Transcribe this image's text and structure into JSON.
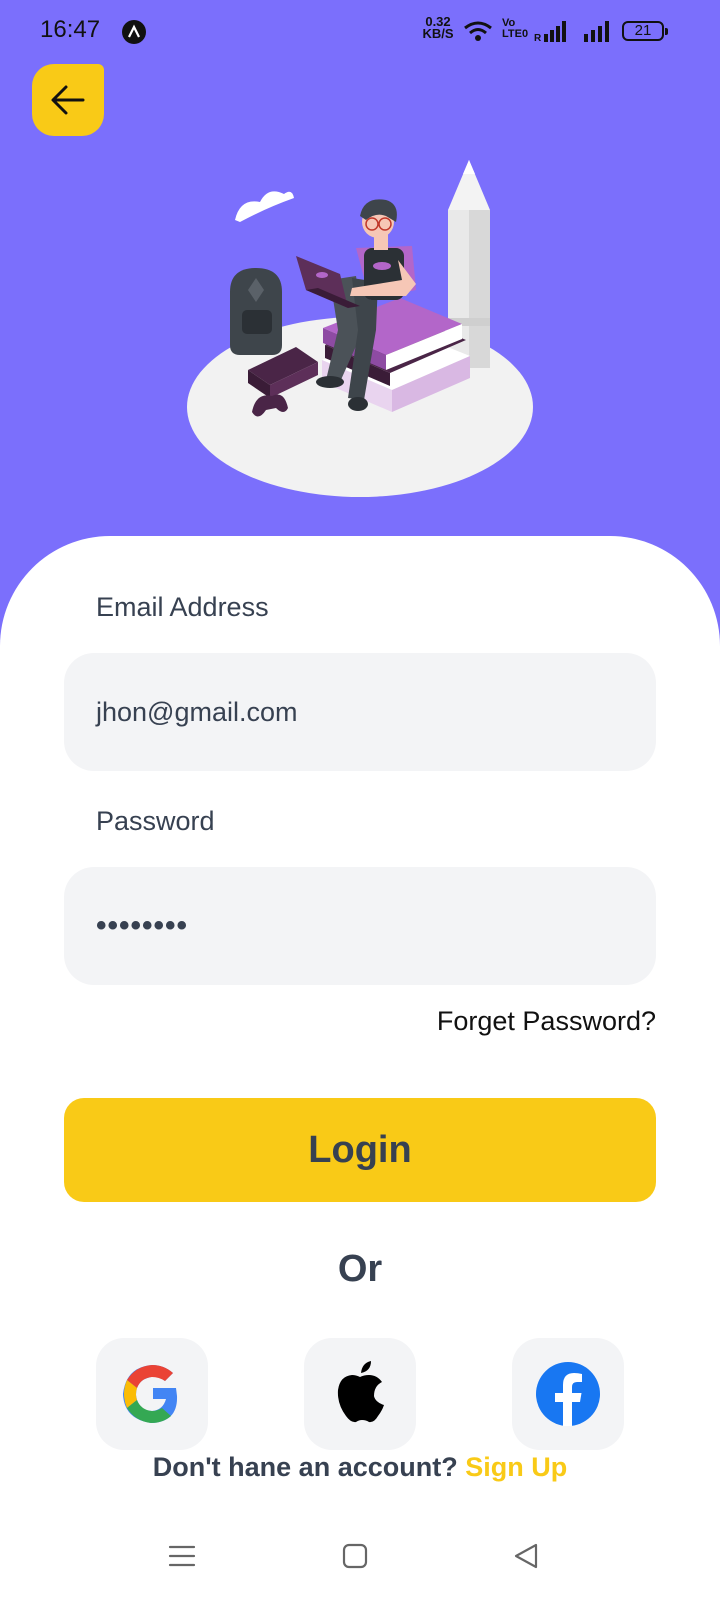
{
  "status_bar": {
    "time": "16:47",
    "speed_value": "0.32",
    "speed_unit": "KB/S",
    "volte_top": "Vo",
    "volte_bottom": "LTE0",
    "battery": "21"
  },
  "form": {
    "email_label": "Email Address",
    "email_value": "jhon@gmail.com",
    "password_label": "Password",
    "password_value": "••••••••",
    "forget_label": "Forget Password?",
    "login_label": "Login",
    "or_label": "Or"
  },
  "signup": {
    "prompt": "Don't hane an account?",
    "link": "Sign Up"
  },
  "colors": {
    "header_bg": "#7b6ffc",
    "accent_yellow": "#f9ca17",
    "field_bg": "#f3f4f6",
    "text_dark": "#374151",
    "illustration_purple": "#b366c9",
    "facebook_blue": "#1877f2"
  },
  "icons": {
    "back": "arrow-left-icon",
    "google": "google-icon",
    "apple": "apple-icon",
    "facebook": "facebook-icon",
    "nav_menu": "menu-icon",
    "nav_home": "square-home-icon",
    "nav_back": "triangle-back-icon"
  }
}
